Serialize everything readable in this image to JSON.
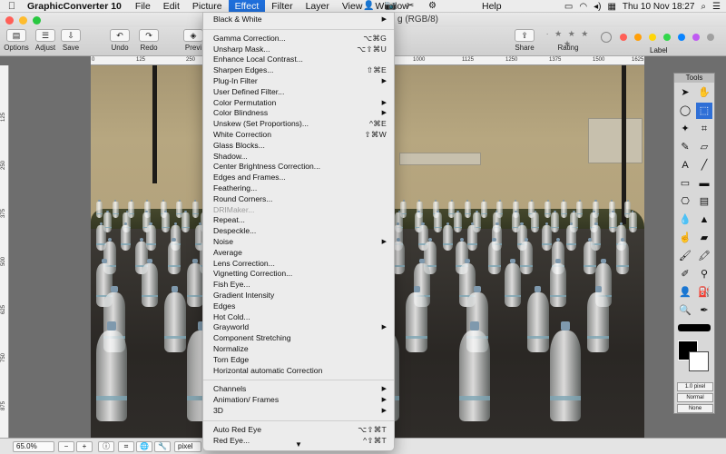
{
  "menubar": {
    "apple": "",
    "app_name": "GraphicConverter 10",
    "menus": [
      "File",
      "Edit",
      "Picture",
      "Effect",
      "Filter",
      "Layer",
      "View",
      "Window",
      "Help"
    ],
    "active_menu": "Effect",
    "clock": "Thu 10 Nov  18:27"
  },
  "window": {
    "title_fragment": "g (RGB/8)"
  },
  "toolbar": {
    "options": "Options",
    "adjust": "Adjust",
    "save": "Save",
    "undo": "Undo",
    "redo": "Redo",
    "preview": "Previ",
    "share": "Share",
    "rating": "Rating",
    "label": "Label",
    "label_colors": [
      "#ff5f57",
      "#ff9f0a",
      "#ffd60a",
      "#32d74b",
      "#0a84ff",
      "#bf5af2",
      "#a0a0a0"
    ]
  },
  "rulers": {
    "top": [
      "0",
      "125",
      "250",
      "1000",
      "1125",
      "1250",
      "1375",
      "1500",
      "1625"
    ],
    "left": [
      "125",
      "250",
      "375",
      "500",
      "625",
      "750",
      "875"
    ]
  },
  "effect_menu": {
    "items": [
      {
        "label": "Black & White",
        "shortcut": "",
        "submenu": true,
        "disabled": false
      },
      {
        "sep": true
      },
      {
        "label": "Gamma Correction...",
        "shortcut": "⌥⌘G",
        "submenu": false,
        "disabled": false
      },
      {
        "label": "Unsharp Mask...",
        "shortcut": "⌥⇧⌘U",
        "submenu": false,
        "disabled": false
      },
      {
        "label": "Enhance Local Contrast...",
        "shortcut": "",
        "submenu": false,
        "disabled": false
      },
      {
        "label": "Sharpen Edges...",
        "shortcut": "⇧⌘E",
        "submenu": false,
        "disabled": false
      },
      {
        "label": "Plug-In Filter",
        "shortcut": "",
        "submenu": true,
        "disabled": false
      },
      {
        "label": "User Defined Filter...",
        "shortcut": "",
        "submenu": false,
        "disabled": false
      },
      {
        "label": "Color Permutation",
        "shortcut": "",
        "submenu": true,
        "disabled": false
      },
      {
        "label": "Color Blindness",
        "shortcut": "",
        "submenu": true,
        "disabled": false
      },
      {
        "label": "Unskew (Set Proportions)...",
        "shortcut": "^⌘E",
        "submenu": false,
        "disabled": false
      },
      {
        "label": "White Correction",
        "shortcut": "⇧⌘W",
        "submenu": false,
        "disabled": false
      },
      {
        "label": "Glass Blocks...",
        "shortcut": "",
        "submenu": false,
        "disabled": false
      },
      {
        "label": "Shadow...",
        "shortcut": "",
        "submenu": false,
        "disabled": false
      },
      {
        "label": "Center Brightness Correction...",
        "shortcut": "",
        "submenu": false,
        "disabled": false
      },
      {
        "label": "Edges and Frames...",
        "shortcut": "",
        "submenu": false,
        "disabled": false
      },
      {
        "label": "Feathering...",
        "shortcut": "",
        "submenu": false,
        "disabled": false
      },
      {
        "label": "Round Corners...",
        "shortcut": "",
        "submenu": false,
        "disabled": false
      },
      {
        "label": "DRIMaker...",
        "shortcut": "",
        "submenu": false,
        "disabled": true
      },
      {
        "label": "Repeat...",
        "shortcut": "",
        "submenu": false,
        "disabled": false
      },
      {
        "label": "Despeckle...",
        "shortcut": "",
        "submenu": false,
        "disabled": false
      },
      {
        "label": "Noise",
        "shortcut": "",
        "submenu": true,
        "disabled": false
      },
      {
        "label": "Average",
        "shortcut": "",
        "submenu": false,
        "disabled": false
      },
      {
        "label": "Lens Correction...",
        "shortcut": "",
        "submenu": false,
        "disabled": false
      },
      {
        "label": "Vignetting Correction...",
        "shortcut": "",
        "submenu": false,
        "disabled": false
      },
      {
        "label": "Fish Eye...",
        "shortcut": "",
        "submenu": false,
        "disabled": false
      },
      {
        "label": "Gradient Intensity",
        "shortcut": "",
        "submenu": false,
        "disabled": false
      },
      {
        "label": "Edges",
        "shortcut": "",
        "submenu": false,
        "disabled": false
      },
      {
        "label": "Hot Cold...",
        "shortcut": "",
        "submenu": false,
        "disabled": false
      },
      {
        "label": "Grayworld",
        "shortcut": "",
        "submenu": true,
        "disabled": false
      },
      {
        "label": "Component Stretching",
        "shortcut": "",
        "submenu": false,
        "disabled": false
      },
      {
        "label": "Normalize",
        "shortcut": "",
        "submenu": false,
        "disabled": false
      },
      {
        "label": "Torn Edge",
        "shortcut": "",
        "submenu": false,
        "disabled": false
      },
      {
        "label": "Horizontal automatic Correction",
        "shortcut": "",
        "submenu": false,
        "disabled": false
      },
      {
        "sep": true
      },
      {
        "label": "Channels",
        "shortcut": "",
        "submenu": true,
        "disabled": false
      },
      {
        "label": "Animation/ Frames",
        "shortcut": "",
        "submenu": true,
        "disabled": false
      },
      {
        "label": "3D",
        "shortcut": "",
        "submenu": true,
        "disabled": false
      },
      {
        "sep": true
      },
      {
        "label": "Auto Red Eye",
        "shortcut": "⌥⇧⌘T",
        "submenu": false,
        "disabled": false
      },
      {
        "label": "Red Eye...",
        "shortcut": "^⇧⌘T",
        "submenu": false,
        "disabled": false
      }
    ],
    "scroll_indicator": "▼"
  },
  "tools_palette": {
    "title": "Tools",
    "pen_size": "1.0 pixel",
    "blend_mode": "Normal",
    "mask": "None"
  },
  "statusbar": {
    "zoom": "65.0%",
    "zoom_out": "−",
    "zoom_in": "+",
    "unit": "pixel"
  }
}
